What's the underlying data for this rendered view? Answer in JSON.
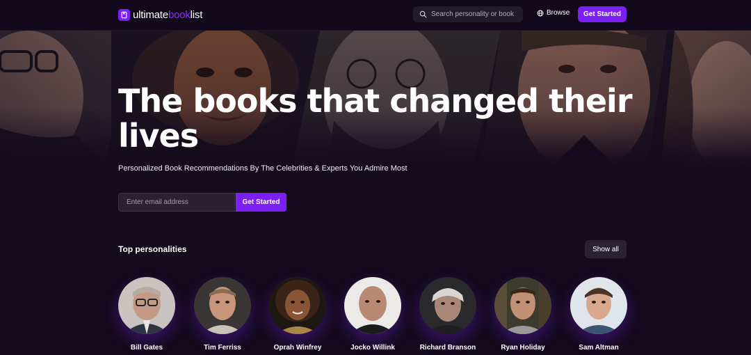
{
  "header": {
    "logo": {
      "part1": "ultimate",
      "part2": "book",
      "part3": "list"
    },
    "search_placeholder": "Search personality or book",
    "browse_label": "Browse",
    "cta_label": "Get Started"
  },
  "hero": {
    "headline": "The books that changed their lives",
    "subline": "Personalized Book Recommendations By The Celebrities & Experts You Admire Most",
    "email_placeholder": "Enter email address",
    "cta_label": "Get Started"
  },
  "personalities": {
    "title": "Top personalities",
    "show_all_label": "Show all",
    "items": [
      {
        "name": "Bill Gates"
      },
      {
        "name": "Tim Ferriss"
      },
      {
        "name": "Oprah Winfrey"
      },
      {
        "name": "Jocko Willink"
      },
      {
        "name": "Richard Branson"
      },
      {
        "name": "Ryan Holiday"
      },
      {
        "name": "Sam Altman"
      }
    ]
  },
  "colors": {
    "accent": "#7b1ff2",
    "background": "#140b1e",
    "nav": "#120a1c",
    "input": "#2a2234"
  },
  "icons": [
    "book-logo-icon",
    "search-icon",
    "globe-icon"
  ]
}
